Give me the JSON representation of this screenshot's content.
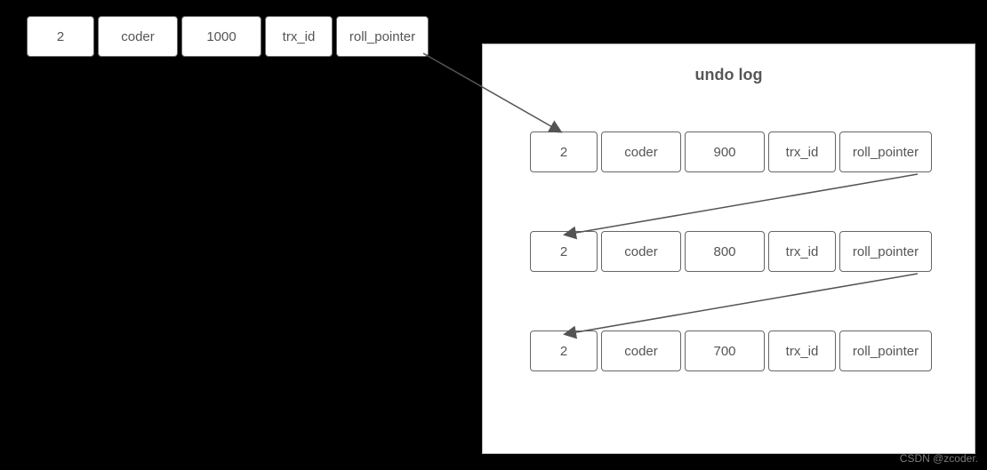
{
  "current_row": {
    "id": "2",
    "name": "coder",
    "value": "1000",
    "trx_label": "trx_id",
    "ptr_label": "roll_pointer"
  },
  "undo_log": {
    "title": "undo log",
    "rows": [
      {
        "id": "2",
        "name": "coder",
        "value": "900",
        "trx_label": "trx_id",
        "ptr_label": "roll_pointer"
      },
      {
        "id": "2",
        "name": "coder",
        "value": "800",
        "trx_label": "trx_id",
        "ptr_label": "roll_pointer"
      },
      {
        "id": "2",
        "name": "coder",
        "value": "700",
        "trx_label": "trx_id",
        "ptr_label": "roll_pointer"
      }
    ]
  },
  "watermark": "CSDN @zcoder."
}
